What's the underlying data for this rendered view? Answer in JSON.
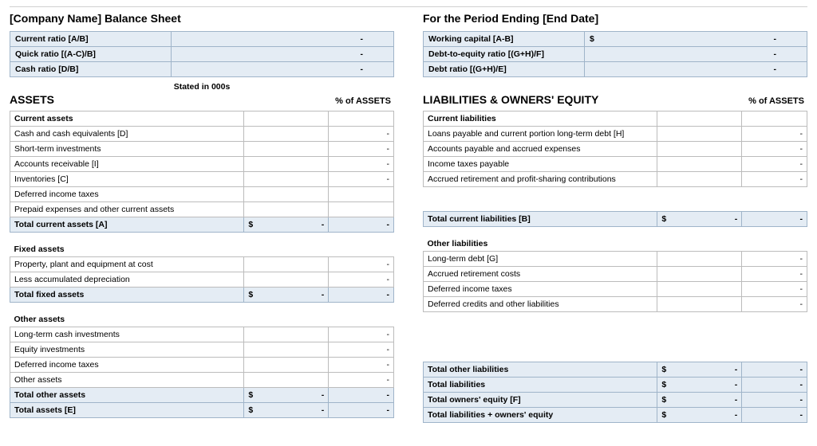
{
  "header": {
    "left_title": "[Company Name] Balance Sheet",
    "right_title": "For the Period Ending [End Date]"
  },
  "ratios_left": {
    "r0": {
      "label": "Current ratio  [A/B]",
      "val": "-"
    },
    "r1": {
      "label": "Quick ratio  [(A-C)/B]",
      "val": "-"
    },
    "r2": {
      "label": "Cash ratio  [D/B]",
      "val": "-"
    }
  },
  "ratios_right": {
    "r0": {
      "label": "Working capital  [A-B]",
      "cur": "$",
      "val": "-"
    },
    "r1": {
      "label": "Debt-to-equity ratio  [(G+H)/F]",
      "val": "-"
    },
    "r2": {
      "label": "Debt ratio  [(G+H)/E]",
      "val": "-"
    }
  },
  "assets": {
    "stated": "Stated in 000s",
    "heading": "ASSETS",
    "pct_heading": "% of ASSETS",
    "current_head": "Current assets",
    "rows_current": {
      "r0": {
        "label": "Cash and cash equivalents  [D]",
        "amt": "",
        "pct": "-"
      },
      "r1": {
        "label": "Short-term investments",
        "amt": "",
        "pct": "-"
      },
      "r2": {
        "label": "Accounts receivable  [I]",
        "amt": "",
        "pct": "-"
      },
      "r3": {
        "label": "Inventories  [C]",
        "amt": "",
        "pct": "-"
      },
      "r4": {
        "label": "Deferred income taxes",
        "amt": "",
        "pct": ""
      },
      "r5": {
        "label": "Prepaid expenses and other current assets",
        "amt": "",
        "pct": ""
      }
    },
    "total_current": {
      "label": "Total current assets  [A]",
      "cur": "$",
      "amt": "-",
      "pct": "-"
    },
    "fixed_head": "Fixed assets",
    "rows_fixed": {
      "r0": {
        "label": "Property, plant and equipment at cost",
        "amt": "",
        "pct": "-"
      },
      "r1": {
        "label": "Less accumulated depreciation",
        "amt": "",
        "pct": "-"
      }
    },
    "total_fixed": {
      "label": "Total fixed assets",
      "cur": "$",
      "amt": "-",
      "pct": "-"
    },
    "other_head": "Other assets",
    "rows_other": {
      "r0": {
        "label": "Long-term cash investments",
        "amt": "",
        "pct": "-"
      },
      "r1": {
        "label": "Equity investments",
        "amt": "",
        "pct": "-"
      },
      "r2": {
        "label": "Deferred income taxes",
        "amt": "",
        "pct": "-"
      },
      "r3": {
        "label": "Other assets",
        "amt": "",
        "pct": "-"
      }
    },
    "total_other": {
      "label": "Total other assets",
      "cur": "$",
      "amt": "-",
      "pct": "-"
    },
    "total_assets": {
      "label": "Total assets  [E]",
      "cur": "$",
      "amt": "-",
      "pct": "-"
    }
  },
  "liab": {
    "heading": "LIABILITIES & OWNERS' EQUITY",
    "pct_heading": "% of ASSETS",
    "current_head": "Current liabilities",
    "rows_current": {
      "r0": {
        "label": "Loans payable and current portion long-term debt  [H]",
        "amt": "",
        "pct": "-"
      },
      "r1": {
        "label": "Accounts payable and accrued expenses",
        "amt": "",
        "pct": "-"
      },
      "r2": {
        "label": "Income taxes payable",
        "amt": "",
        "pct": "-"
      },
      "r3": {
        "label": "Accrued retirement and profit-sharing contributions",
        "amt": "",
        "pct": "-"
      }
    },
    "total_current": {
      "label": "Total current liabilities  [B]",
      "cur": "$",
      "amt": "-",
      "pct": "-"
    },
    "other_head": "Other liabilities",
    "rows_other": {
      "r0": {
        "label": "Long-term debt  [G]",
        "amt": "",
        "pct": "-"
      },
      "r1": {
        "label": "Accrued retirement costs",
        "amt": "",
        "pct": "-"
      },
      "r2": {
        "label": "Deferred income taxes",
        "amt": "",
        "pct": "-"
      },
      "r3": {
        "label": "Deferred credits and other liabilities",
        "amt": "",
        "pct": "-"
      }
    },
    "total_other": {
      "label": "Total other liabilities",
      "cur": "$",
      "amt": "-",
      "pct": "-"
    },
    "total_liab": {
      "label": "Total liabilities",
      "cur": "$",
      "amt": "-",
      "pct": "-"
    },
    "total_equity": {
      "label": "Total owners' equity  [F]",
      "cur": "$",
      "amt": "-",
      "pct": "-"
    },
    "total_all": {
      "label": "Total liabilities + owners' equity",
      "cur": "$",
      "amt": "-",
      "pct": "-"
    }
  }
}
